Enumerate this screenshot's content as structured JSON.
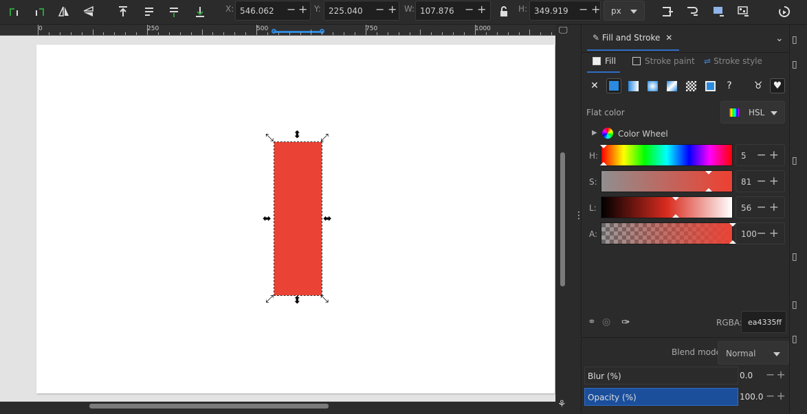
{
  "toolbar": {
    "x": {
      "label": "X:",
      "value": "546.062"
    },
    "y": {
      "label": "Y:",
      "value": "225.040"
    },
    "w": {
      "label": "W:",
      "value": "107.876"
    },
    "h": {
      "label": "H:",
      "value": "349.919"
    },
    "unit": "px"
  },
  "ruler": {
    "labels": [
      "0",
      "250",
      "500",
      "750",
      "1000"
    ]
  },
  "panel": {
    "tab_title": "Fill and Stroke",
    "subtabs": {
      "fill": "Fill",
      "stroke_paint": "Stroke paint",
      "stroke_style": "Stroke style"
    },
    "flat_color_label": "Flat color",
    "color_mode": "HSL",
    "color_wheel_label": "Color Wheel",
    "sliders": {
      "h": {
        "label": "H:",
        "value": "5"
      },
      "s": {
        "label": "S:",
        "value": "81"
      },
      "l": {
        "label": "L:",
        "value": "56"
      },
      "a": {
        "label": "A:",
        "value": "100"
      }
    },
    "rgba_label": "RGBA:",
    "rgba_value": "ea4335ff",
    "blend_label": "Blend mode:",
    "blend_value": "Normal",
    "blur": {
      "label": "Blur (%)",
      "value": "0.0"
    },
    "opacity": {
      "label": "Opacity (%)",
      "value": "100.0"
    }
  },
  "colors": {
    "fill": "#ea4335",
    "accent": "#2f6ec8",
    "opacity_bar": "#1b4f9c"
  }
}
